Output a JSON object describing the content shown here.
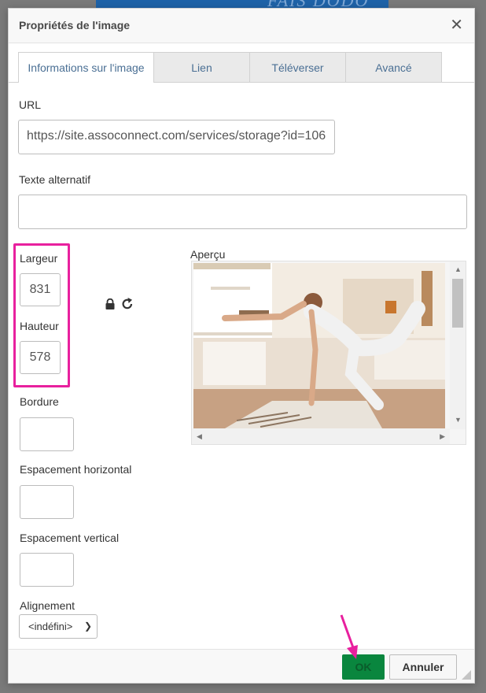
{
  "background": {
    "banner_text": "FAIS DODO BAT"
  },
  "dialog": {
    "title": "Propriétés de l'image",
    "close_icon": "close-icon"
  },
  "tabs": [
    {
      "label": "Informations sur l'image",
      "active": true
    },
    {
      "label": "Lien",
      "active": false
    },
    {
      "label": "Téléverser",
      "active": false
    },
    {
      "label": "Avancé",
      "active": false
    }
  ],
  "form": {
    "url_label": "URL",
    "url_value": "https://site.assoconnect.com/services/storage?id=106",
    "alt_label": "Texte alternatif",
    "alt_value": "",
    "width_label": "Largeur",
    "width_value": "831",
    "height_label": "Hauteur",
    "height_value": "578",
    "border_label": "Bordure",
    "border_value": "",
    "hspace_label": "Espacement horizontal",
    "hspace_value": "",
    "vspace_label": "Espacement vertical",
    "vspace_value": "",
    "align_label": "Alignement",
    "align_value": "<indéfini>"
  },
  "preview": {
    "label": "Aperçu"
  },
  "footer": {
    "ok_label": "OK",
    "cancel_label": "Annuler"
  },
  "colors": {
    "highlight": "#e8209e",
    "ok_button": "#09863e",
    "tab_text": "#4a6f94"
  }
}
